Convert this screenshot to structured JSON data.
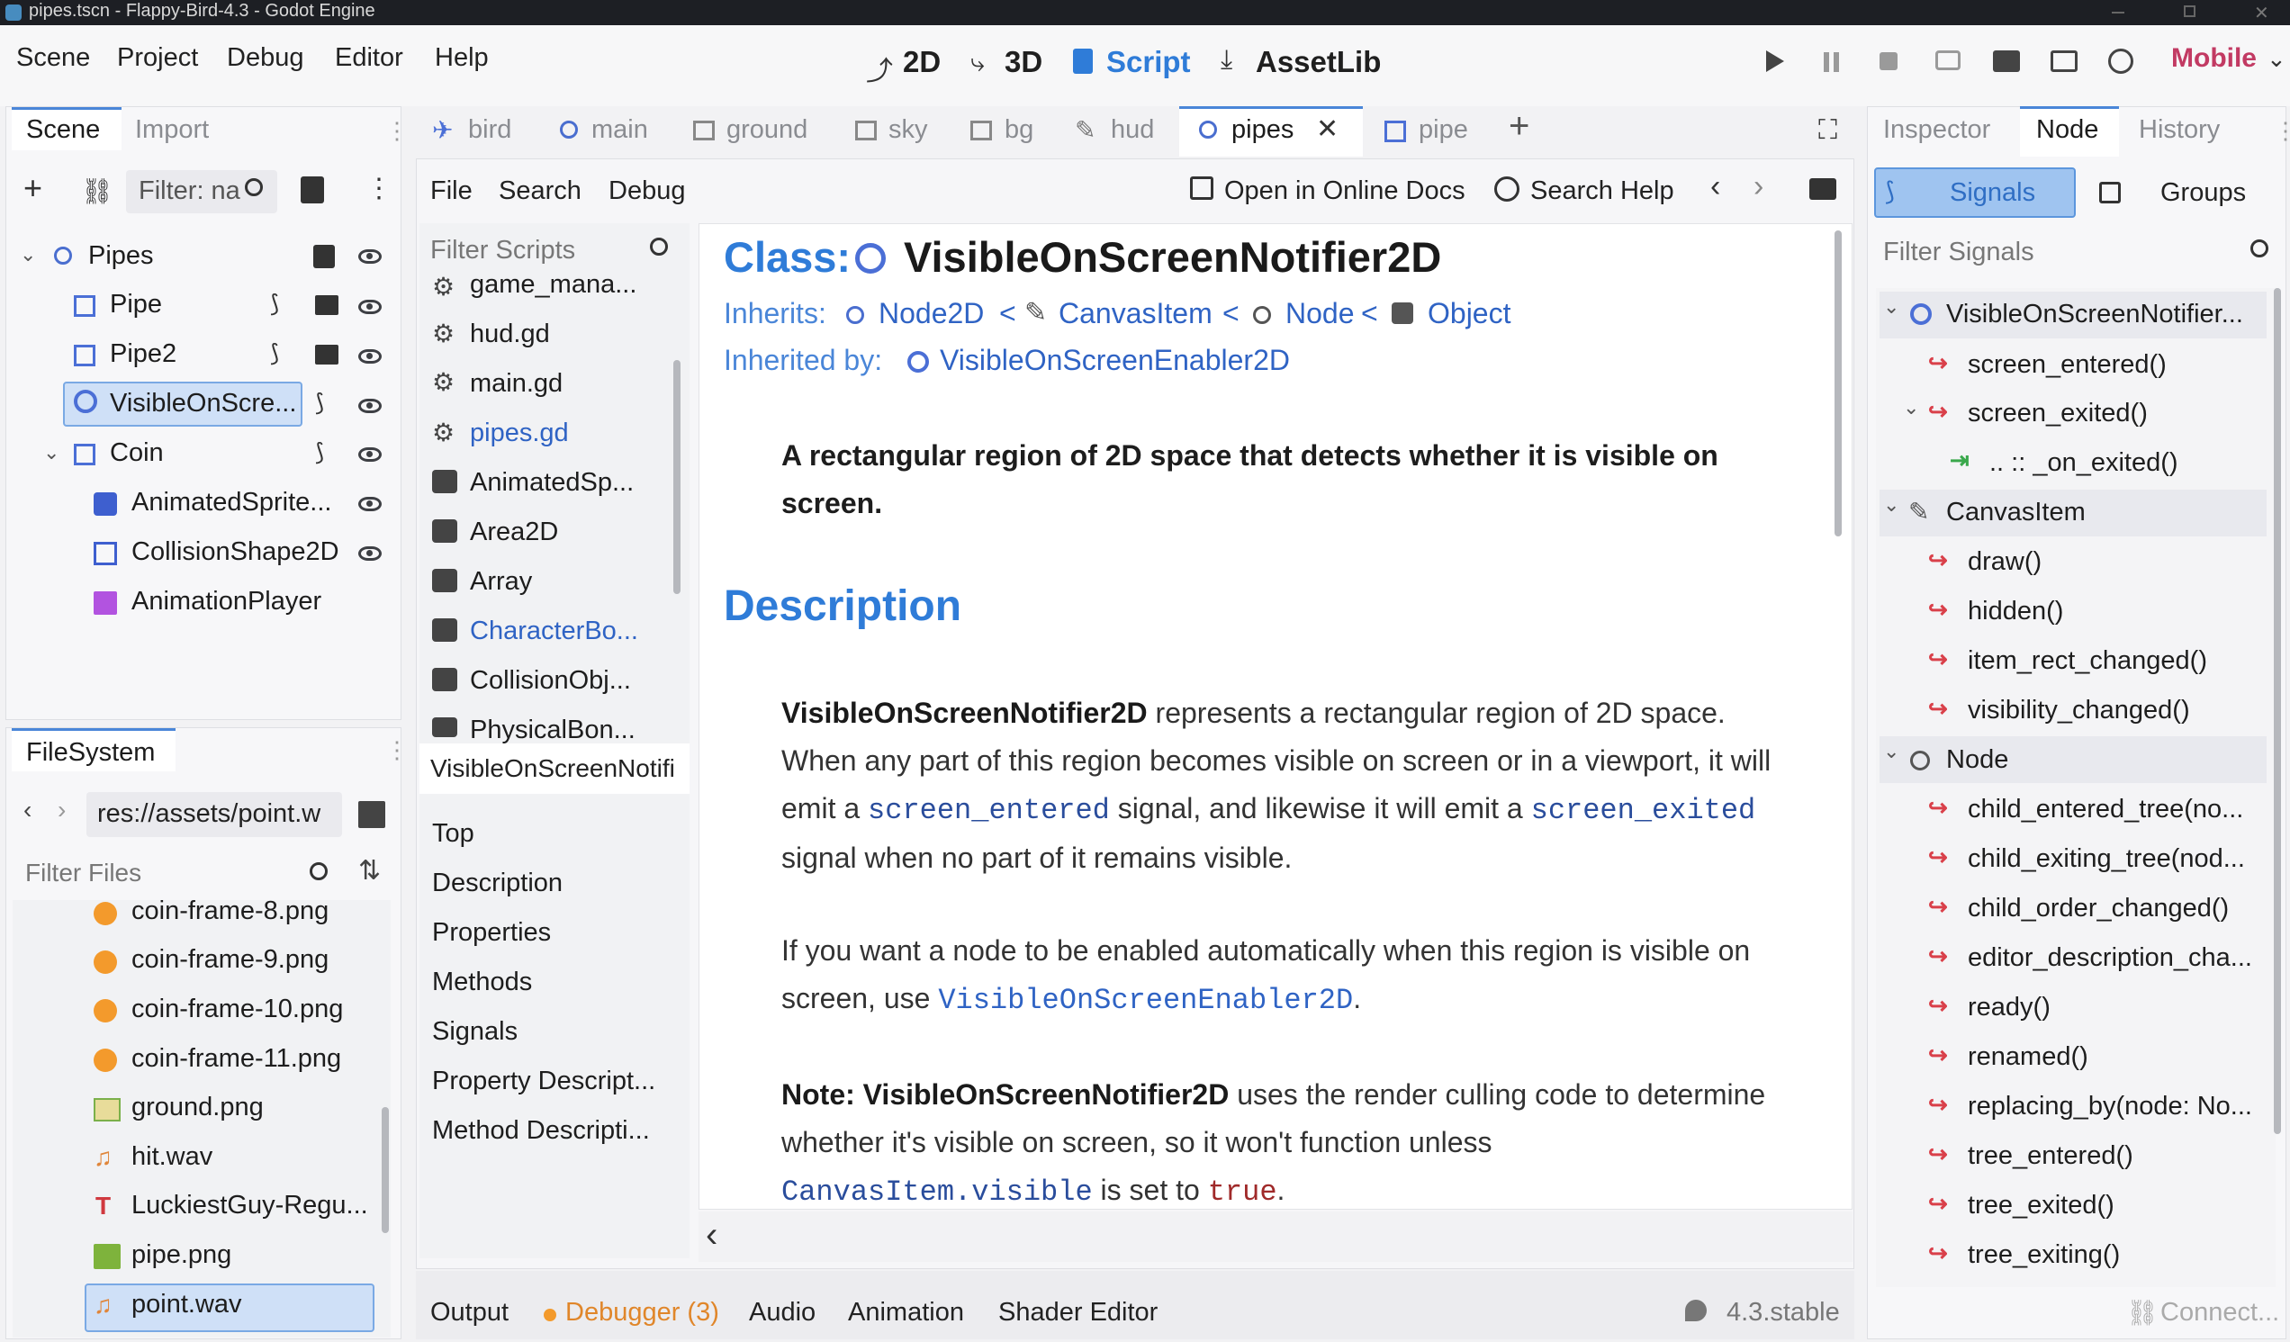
{
  "window": {
    "title": "pipes.tscn - Flappy-Bird-4.3 - Godot Engine"
  },
  "menu": {
    "items": [
      "Scene",
      "Project",
      "Debug",
      "Editor",
      "Help"
    ]
  },
  "workspaces": {
    "items": [
      "2D",
      "3D",
      "Script",
      "AssetLib"
    ],
    "active": "Script"
  },
  "renderer": "Mobile",
  "left_dock": {
    "tabs": [
      "Scene",
      "Import"
    ],
    "filter_placeholder": "Filter: na",
    "tree": [
      {
        "label": "Pipes"
      },
      {
        "label": "Pipe"
      },
      {
        "label": "Pipe2"
      },
      {
        "label": "VisibleOnScre..."
      },
      {
        "label": "Coin"
      },
      {
        "label": "AnimatedSprite..."
      },
      {
        "label": "CollisionShape2D"
      },
      {
        "label": "AnimationPlayer"
      }
    ]
  },
  "filesystem": {
    "tab": "FileSystem",
    "path": "res://assets/point.w",
    "filter_placeholder": "Filter Files",
    "files": [
      "coin-frame-8.png",
      "coin-frame-9.png",
      "coin-frame-10.png",
      "coin-frame-11.png",
      "ground.png",
      "hit.wav",
      "LuckiestGuy-Regu...",
      "pipe.png",
      "point.wav"
    ]
  },
  "editor_tabs": [
    "bird",
    "main",
    "ground",
    "sky",
    "bg",
    "hud",
    "pipes",
    "pipe"
  ],
  "script_menu": {
    "items": [
      "File",
      "Search",
      "Debug"
    ],
    "online_docs": "Open in Online Docs",
    "search_help": "Search Help"
  },
  "script_list": {
    "filter_placeholder": "Filter Scripts",
    "items": [
      "game_mana...",
      "hud.gd",
      "main.gd",
      "pipes.gd",
      "AnimatedSp...",
      "Area2D",
      "Array",
      "CharacterBo...",
      "CollisionObj...",
      "PhysicalBon..."
    ],
    "current": "VisibleOnScreenNotifi",
    "outline": [
      "Top",
      "Description",
      "Properties",
      "Methods",
      "Signals",
      "Property Descript...",
      "Method Descripti..."
    ]
  },
  "doc": {
    "class_prefix": "Class:",
    "class_name": "VisibleOnScreenNotifier2D",
    "inherits_label": "Inherits:",
    "inherits": [
      "Node2D",
      "CanvasItem",
      "Node",
      "Object"
    ],
    "inherited_by_label": "Inherited by:",
    "inherited_by": "VisibleOnScreenEnabler2D",
    "brief": "A rectangular region of 2D space that detects whether it is visible on screen.",
    "description_heading": "Description",
    "p1_bold": "VisibleOnScreenNotifier2D",
    "p1_a": " represents a rectangular region of 2D space. When any part of this region becomes visible on screen or in a viewport, it will emit a ",
    "p1_code1": "screen_entered",
    "p1_b": " signal, and likewise it will emit a ",
    "p1_code2": "screen_exited",
    "p1_c": " signal when no part of it remains visible.",
    "p2_a": "If you want a node to be enabled automatically when this region is visible on screen, use ",
    "p2_code": "VisibleOnScreenEnabler2D",
    "p2_b": ".",
    "p3_bold": "Note: VisibleOnScreenNotifier2D",
    "p3_a": " uses the render culling code to determine whether it's visible on screen, so it won't function unless ",
    "p3_code": "CanvasItem.visible",
    "p3_b": " is set to ",
    "p3_code2": "true",
    "p3_c": "."
  },
  "bottom_panel": {
    "tabs": [
      "Output",
      "Debugger (3)",
      "Audio",
      "Animation",
      "Shader Editor"
    ],
    "version": "4.3.stable"
  },
  "right_dock": {
    "tabs": [
      "Inspector",
      "Node",
      "History"
    ],
    "subtabs": [
      "Signals",
      "Groups"
    ],
    "filter_placeholder": "Filter Signals",
    "groups": [
      {
        "name": "VisibleOnScreenNotifier...",
        "signals": [
          "screen_entered()",
          "screen_exited()"
        ],
        "connection": ".. :: _on_exited()"
      },
      {
        "name": "CanvasItem",
        "signals": [
          "draw()",
          "hidden()",
          "item_rect_changed()",
          "visibility_changed()"
        ]
      },
      {
        "name": "Node",
        "signals": [
          "child_entered_tree(no...",
          "child_exiting_tree(nod...",
          "child_order_changed()",
          "editor_description_cha...",
          "ready()",
          "renamed()",
          "replacing_by(node: No...",
          "tree_entered()",
          "tree_exited()",
          "tree_exiting()"
        ]
      }
    ],
    "connect_label": "Connect..."
  }
}
